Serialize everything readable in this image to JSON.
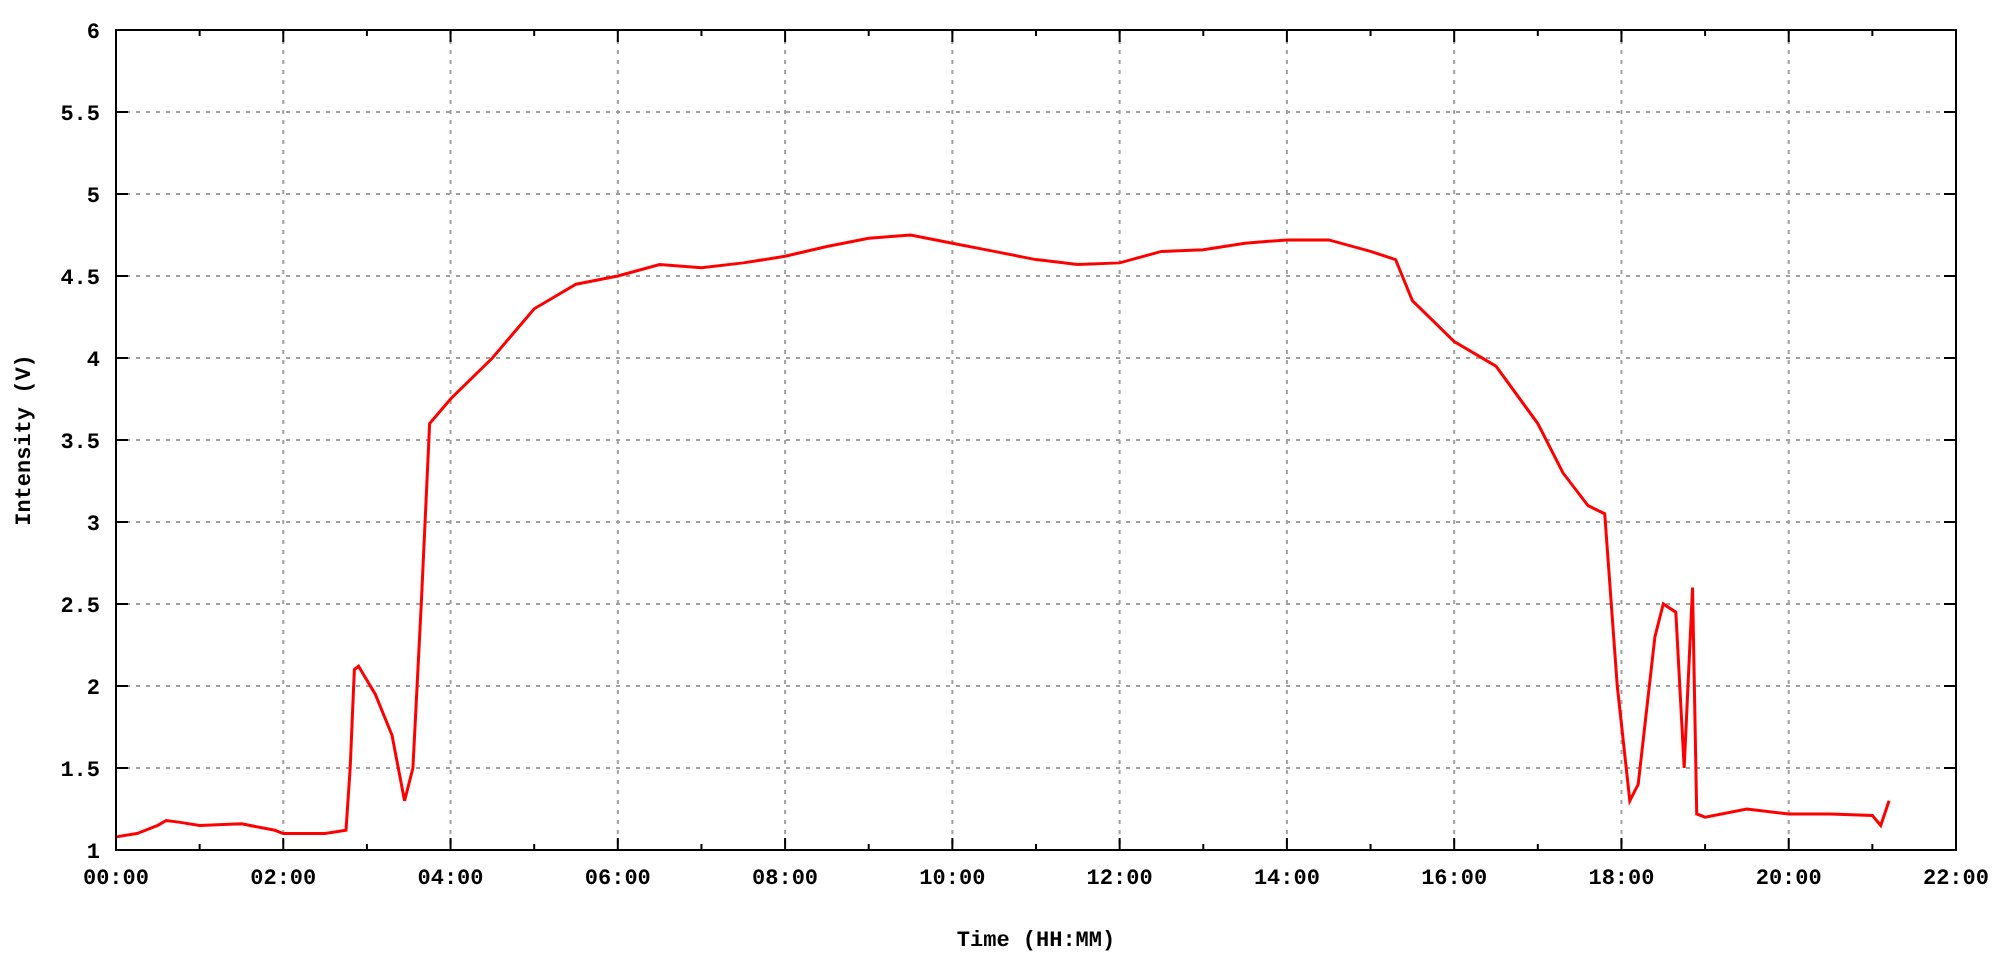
{
  "chart_data": {
    "type": "line",
    "xlabel": "Time (HH:MM)",
    "ylabel": "Intensity (V)",
    "x": [
      0,
      0.25,
      0.5,
      0.6,
      0.75,
      1,
      1.5,
      1.9,
      2,
      2.5,
      2.75,
      2.8,
      2.85,
      2.9,
      3.1,
      3.3,
      3.45,
      3.55,
      3.65,
      3.75,
      4,
      4.5,
      5,
      5.5,
      6,
      6.5,
      7,
      7.5,
      8,
      8.5,
      9,
      9.5,
      10,
      10.5,
      11,
      11.5,
      12,
      12.5,
      13,
      13.5,
      14,
      14.5,
      15,
      15.3,
      15.5,
      16,
      16.5,
      17,
      17.3,
      17.6,
      17.8,
      17.95,
      18.1,
      18.2,
      18.4,
      18.5,
      18.65,
      18.75,
      18.85,
      18.9,
      19,
      19.5,
      20,
      20.5,
      21,
      21.1,
      21.2
    ],
    "grid": true,
    "series": [
      {
        "color": "#ff0000",
        "values": [
          1.08,
          1.1,
          1.15,
          1.18,
          1.17,
          1.15,
          1.16,
          1.12,
          1.1,
          1.1,
          1.12,
          1.5,
          2.1,
          2.12,
          1.95,
          1.7,
          1.3,
          1.5,
          2.5,
          3.6,
          3.75,
          4.0,
          4.3,
          4.45,
          4.5,
          4.57,
          4.55,
          4.58,
          4.62,
          4.68,
          4.73,
          4.75,
          4.7,
          4.65,
          4.6,
          4.57,
          4.58,
          4.65,
          4.66,
          4.7,
          4.72,
          4.72,
          4.65,
          4.6,
          4.35,
          4.1,
          3.95,
          3.6,
          3.3,
          3.1,
          3.05,
          2.0,
          1.3,
          1.4,
          2.3,
          2.5,
          2.45,
          1.5,
          2.6,
          1.22,
          1.2,
          1.25,
          1.22,
          1.22,
          1.21,
          1.15,
          1.3
        ]
      }
    ],
    "xlim": [
      0,
      22
    ],
    "ylim": [
      1,
      6
    ],
    "xticks": [
      {
        "value": 0,
        "label": "00:00"
      },
      {
        "value": 2,
        "label": "02:00"
      },
      {
        "value": 4,
        "label": "04:00"
      },
      {
        "value": 6,
        "label": "06:00"
      },
      {
        "value": 8,
        "label": "08:00"
      },
      {
        "value": 10,
        "label": "10:00"
      },
      {
        "value": 12,
        "label": "12:00"
      },
      {
        "value": 14,
        "label": "14:00"
      },
      {
        "value": 16,
        "label": "16:00"
      },
      {
        "value": 18,
        "label": "18:00"
      },
      {
        "value": 20,
        "label": "20:00"
      },
      {
        "value": 22,
        "label": "22:00"
      }
    ],
    "yticks": [
      1,
      1.5,
      2,
      2.5,
      3,
      3.5,
      4,
      4.5,
      5,
      5.5,
      6
    ]
  }
}
